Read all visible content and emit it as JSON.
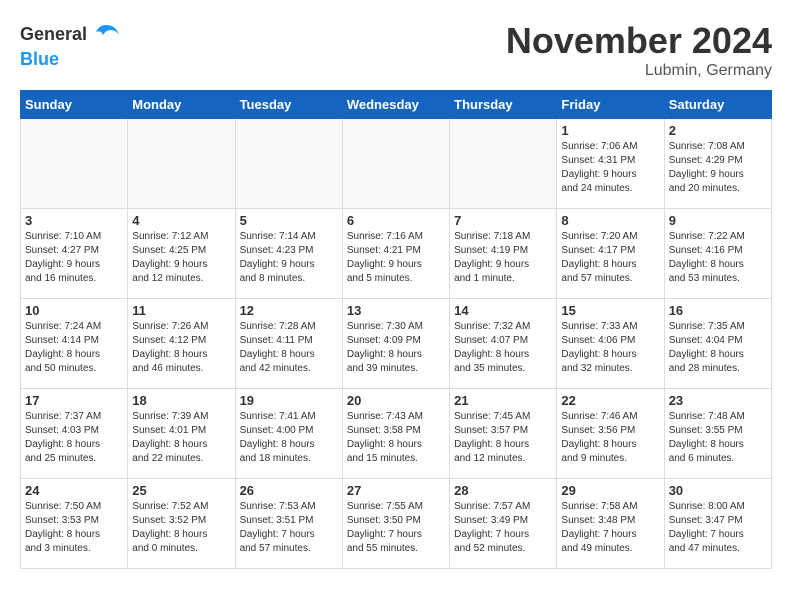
{
  "logo": {
    "general": "General",
    "blue": "Blue"
  },
  "header": {
    "month": "November 2024",
    "location": "Lubmin, Germany"
  },
  "weekdays": [
    "Sunday",
    "Monday",
    "Tuesday",
    "Wednesday",
    "Thursday",
    "Friday",
    "Saturday"
  ],
  "weeks": [
    [
      {
        "day": "",
        "info": ""
      },
      {
        "day": "",
        "info": ""
      },
      {
        "day": "",
        "info": ""
      },
      {
        "day": "",
        "info": ""
      },
      {
        "day": "",
        "info": ""
      },
      {
        "day": "1",
        "info": "Sunrise: 7:06 AM\nSunset: 4:31 PM\nDaylight: 9 hours\nand 24 minutes."
      },
      {
        "day": "2",
        "info": "Sunrise: 7:08 AM\nSunset: 4:29 PM\nDaylight: 9 hours\nand 20 minutes."
      }
    ],
    [
      {
        "day": "3",
        "info": "Sunrise: 7:10 AM\nSunset: 4:27 PM\nDaylight: 9 hours\nand 16 minutes."
      },
      {
        "day": "4",
        "info": "Sunrise: 7:12 AM\nSunset: 4:25 PM\nDaylight: 9 hours\nand 12 minutes."
      },
      {
        "day": "5",
        "info": "Sunrise: 7:14 AM\nSunset: 4:23 PM\nDaylight: 9 hours\nand 8 minutes."
      },
      {
        "day": "6",
        "info": "Sunrise: 7:16 AM\nSunset: 4:21 PM\nDaylight: 9 hours\nand 5 minutes."
      },
      {
        "day": "7",
        "info": "Sunrise: 7:18 AM\nSunset: 4:19 PM\nDaylight: 9 hours\nand 1 minute."
      },
      {
        "day": "8",
        "info": "Sunrise: 7:20 AM\nSunset: 4:17 PM\nDaylight: 8 hours\nand 57 minutes."
      },
      {
        "day": "9",
        "info": "Sunrise: 7:22 AM\nSunset: 4:16 PM\nDaylight: 8 hours\nand 53 minutes."
      }
    ],
    [
      {
        "day": "10",
        "info": "Sunrise: 7:24 AM\nSunset: 4:14 PM\nDaylight: 8 hours\nand 50 minutes."
      },
      {
        "day": "11",
        "info": "Sunrise: 7:26 AM\nSunset: 4:12 PM\nDaylight: 8 hours\nand 46 minutes."
      },
      {
        "day": "12",
        "info": "Sunrise: 7:28 AM\nSunset: 4:11 PM\nDaylight: 8 hours\nand 42 minutes."
      },
      {
        "day": "13",
        "info": "Sunrise: 7:30 AM\nSunset: 4:09 PM\nDaylight: 8 hours\nand 39 minutes."
      },
      {
        "day": "14",
        "info": "Sunrise: 7:32 AM\nSunset: 4:07 PM\nDaylight: 8 hours\nand 35 minutes."
      },
      {
        "day": "15",
        "info": "Sunrise: 7:33 AM\nSunset: 4:06 PM\nDaylight: 8 hours\nand 32 minutes."
      },
      {
        "day": "16",
        "info": "Sunrise: 7:35 AM\nSunset: 4:04 PM\nDaylight: 8 hours\nand 28 minutes."
      }
    ],
    [
      {
        "day": "17",
        "info": "Sunrise: 7:37 AM\nSunset: 4:03 PM\nDaylight: 8 hours\nand 25 minutes."
      },
      {
        "day": "18",
        "info": "Sunrise: 7:39 AM\nSunset: 4:01 PM\nDaylight: 8 hours\nand 22 minutes."
      },
      {
        "day": "19",
        "info": "Sunrise: 7:41 AM\nSunset: 4:00 PM\nDaylight: 8 hours\nand 18 minutes."
      },
      {
        "day": "20",
        "info": "Sunrise: 7:43 AM\nSunset: 3:58 PM\nDaylight: 8 hours\nand 15 minutes."
      },
      {
        "day": "21",
        "info": "Sunrise: 7:45 AM\nSunset: 3:57 PM\nDaylight: 8 hours\nand 12 minutes."
      },
      {
        "day": "22",
        "info": "Sunrise: 7:46 AM\nSunset: 3:56 PM\nDaylight: 8 hours\nand 9 minutes."
      },
      {
        "day": "23",
        "info": "Sunrise: 7:48 AM\nSunset: 3:55 PM\nDaylight: 8 hours\nand 6 minutes."
      }
    ],
    [
      {
        "day": "24",
        "info": "Sunrise: 7:50 AM\nSunset: 3:53 PM\nDaylight: 8 hours\nand 3 minutes."
      },
      {
        "day": "25",
        "info": "Sunrise: 7:52 AM\nSunset: 3:52 PM\nDaylight: 8 hours\nand 0 minutes."
      },
      {
        "day": "26",
        "info": "Sunrise: 7:53 AM\nSunset: 3:51 PM\nDaylight: 7 hours\nand 57 minutes."
      },
      {
        "day": "27",
        "info": "Sunrise: 7:55 AM\nSunset: 3:50 PM\nDaylight: 7 hours\nand 55 minutes."
      },
      {
        "day": "28",
        "info": "Sunrise: 7:57 AM\nSunset: 3:49 PM\nDaylight: 7 hours\nand 52 minutes."
      },
      {
        "day": "29",
        "info": "Sunrise: 7:58 AM\nSunset: 3:48 PM\nDaylight: 7 hours\nand 49 minutes."
      },
      {
        "day": "30",
        "info": "Sunrise: 8:00 AM\nSunset: 3:47 PM\nDaylight: 7 hours\nand 47 minutes."
      }
    ]
  ]
}
